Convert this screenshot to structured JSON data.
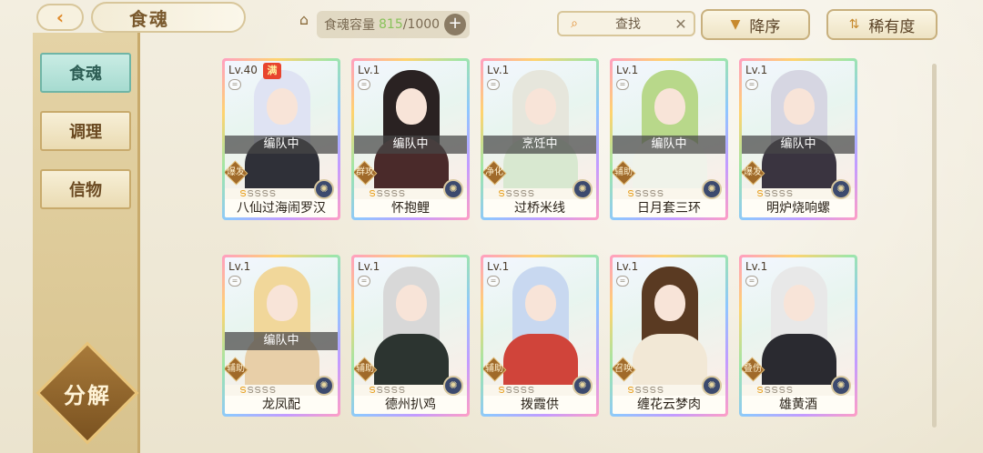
{
  "header": {
    "back_label": "‹",
    "title": "食魂",
    "capacity_label": "食魂容量",
    "capacity_current": "815",
    "capacity_total": "/1000",
    "capacity_add": "+",
    "search_placeholder": "查找",
    "search_clear": "✕",
    "sort_order_label": "降序",
    "sort_key_label": "稀有度"
  },
  "sidebar": {
    "items": [
      {
        "label": "食魂",
        "active": true
      },
      {
        "label": "调理",
        "active": false
      },
      {
        "label": "信物",
        "active": false
      }
    ],
    "decompose_label": "分解"
  },
  "cards": [
    {
      "level": "Lv.40",
      "max_badge": "满",
      "status": "编队中",
      "role": "爆发",
      "stars": 1,
      "name": "八仙过海闹罗汉",
      "hair": "#dfe3f3",
      "outfit": "#2f3038"
    },
    {
      "level": "Lv.1",
      "max_badge": "",
      "status": "编队中",
      "role": "群攻",
      "stars": 1,
      "name": "怀抱鲤",
      "hair": "#2a2222",
      "outfit": "#4a2a2a"
    },
    {
      "level": "Lv.1",
      "max_badge": "",
      "status": "烹饪中",
      "role": "净化",
      "stars": 1,
      "name": "过桥米线",
      "hair": "#e6e6dc",
      "outfit": "#d8e8d0"
    },
    {
      "level": "Lv.1",
      "max_badge": "",
      "status": "编队中",
      "role": "辅助",
      "stars": 1,
      "name": "日月套三环",
      "hair": "#b8d88a",
      "outfit": "#f0f3ea"
    },
    {
      "level": "Lv.1",
      "max_badge": "",
      "status": "编队中",
      "role": "爆发",
      "stars": 1,
      "name": "明炉烧响螺",
      "hair": "#d6d6e2",
      "outfit": "#3a3440"
    },
    {
      "level": "Lv.1",
      "max_badge": "",
      "status": "编队中",
      "role": "辅助",
      "stars": 1,
      "name": "龙凤配",
      "hair": "#f1d79a",
      "outfit": "#e8cfa8"
    },
    {
      "level": "Lv.1",
      "max_badge": "",
      "status": "",
      "role": "辅助",
      "stars": 1,
      "name": "德州扒鸡",
      "hair": "#d8d8d8",
      "outfit": "#2c3430"
    },
    {
      "level": "Lv.1",
      "max_badge": "",
      "status": "",
      "role": "辅助",
      "stars": 1,
      "name": "拨霞供",
      "hair": "#c8d8f0",
      "outfit": "#d0443a"
    },
    {
      "level": "Lv.1",
      "max_badge": "",
      "status": "",
      "role": "召唤",
      "stars": 1,
      "name": "缠花云梦肉",
      "hair": "#5a3a22",
      "outfit": "#f2e8d6"
    },
    {
      "level": "Lv.1",
      "max_badge": "",
      "status": "",
      "role": "叠伤",
      "stars": 1,
      "name": "雄黄酒",
      "hair": "#e8e8e8",
      "outfit": "#2a2a30"
    }
  ]
}
